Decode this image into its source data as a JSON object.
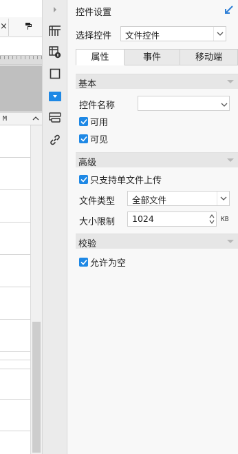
{
  "left": {
    "tab_close": "×",
    "column_label": "M"
  },
  "panel": {
    "title": "控件设置",
    "select_control": {
      "label": "选择控件",
      "value": "文件控件"
    },
    "tabs": [
      {
        "label": "属性",
        "active": true
      },
      {
        "label": "事件",
        "active": false
      },
      {
        "label": "移动端",
        "active": false
      }
    ],
    "sections": {
      "basic": {
        "label": "基本",
        "control_name_label": "控件名称",
        "control_name_value": "",
        "enabled": {
          "label": "可用",
          "checked": true
        },
        "visible": {
          "label": "可见",
          "checked": true
        }
      },
      "advanced": {
        "label": "高级",
        "single_upload": {
          "label": "只支持单文件上传",
          "checked": true
        },
        "file_type_label": "文件类型",
        "file_type_value": "全部文件",
        "size_limit_label": "大小限制",
        "size_limit_value": "1024",
        "size_unit": "KB"
      },
      "validation": {
        "label": "校验",
        "allow_empty": {
          "label": "允许为空",
          "checked": true
        }
      }
    }
  },
  "colors": {
    "accent": "#1e88e5",
    "pin": "#2f7fd6"
  }
}
